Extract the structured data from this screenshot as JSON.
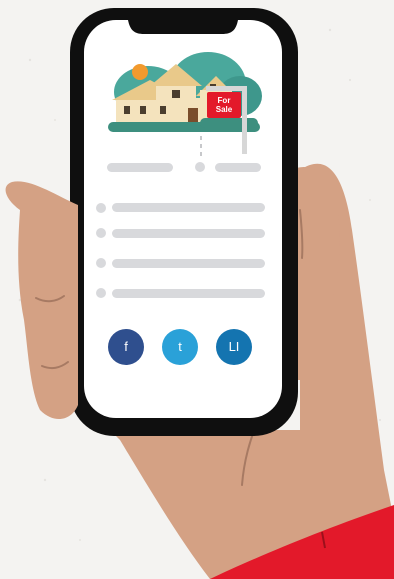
{
  "sale_sign": {
    "line1": "For",
    "line2": "Sale"
  },
  "social": [
    {
      "id": "facebook",
      "label": "f",
      "color": "#2f4f8e"
    },
    {
      "id": "twitter",
      "label": "t",
      "color": "#2aa1d8"
    },
    {
      "id": "linkedin",
      "label": "LI",
      "color": "#1474b0"
    }
  ],
  "colors": {
    "background": "#f4f3f1",
    "phone_body": "#0f0f0f",
    "screen": "#ffffff",
    "skin": "#d4a184",
    "sleeve": "#e3192a",
    "placeholder": "#d8d9dc"
  }
}
